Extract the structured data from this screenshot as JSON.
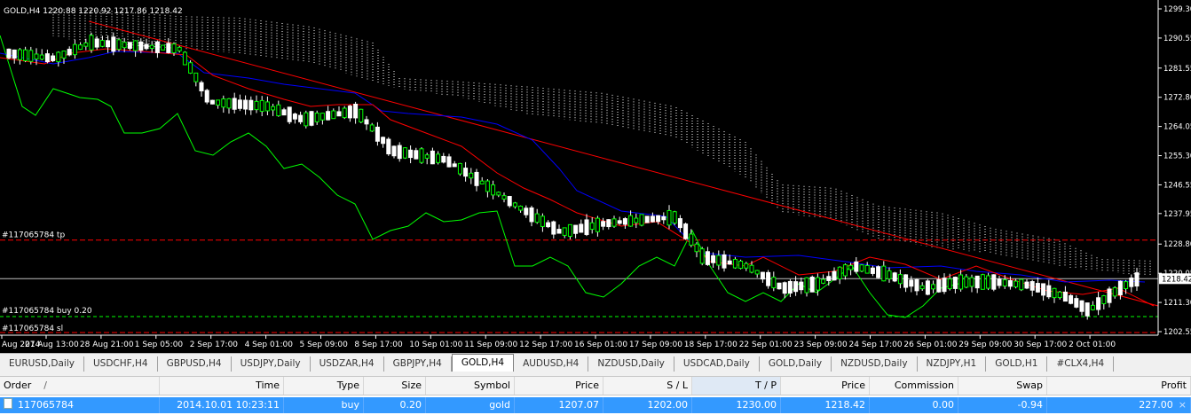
{
  "chart": {
    "symbol_label": "GOLD,H4",
    "ohlc": "1220.88 1220.92 1217.86 1218.42",
    "price_ticks": [
      "1299.30",
      "1290.55",
      "1281.55",
      "1272.80",
      "1264.05",
      "1255.30",
      "1246.55",
      "1237.95",
      "1228.80",
      "1220.05",
      "1211.30",
      "1202.55"
    ],
    "current_price": "1218.42",
    "time_labels": [
      "Aug 2014",
      "27 Aug 13:00",
      "28 Aug 21:00",
      "1 Sep 05:00",
      "2 Sep 17:00",
      "4 Sep 01:00",
      "5 Sep 09:00",
      "8 Sep 17:00",
      "10 Sep 01:00",
      "11 Sep 09:00",
      "12 Sep 17:00",
      "16 Sep 01:00",
      "17 Sep 09:00",
      "18 Sep 17:00",
      "22 Sep 01:00",
      "23 Sep 09:00",
      "24 Sep 17:00",
      "26 Sep 01:00",
      "29 Sep 09:00",
      "30 Sep 17:00",
      "2 Oct 01:00"
    ],
    "order_lines": {
      "tp_label": "#117065784 tp",
      "buy_label": "#117065784 buy 0.20",
      "sl_label": "#117065784 sl"
    },
    "colors": {
      "background": "#000000",
      "bull": "#ffffff",
      "bear": "#00ff00",
      "trend": "#ff0000",
      "kijun": "#0000ff",
      "tenkan": "#ff0000",
      "chikou": "#00ff00",
      "tp_line": "#ff0000",
      "buy_line": "#00ff00"
    }
  },
  "tabs": [
    "EURUSD,Daily",
    "USDCHF,H4",
    "GBPUSD,H4",
    "USDJPY,Daily",
    "USDZAR,H4",
    "GBPJPY,H4",
    "GOLD,H4",
    "AUDUSD,H4",
    "NZDUSD,Daily",
    "USDCAD,Daily",
    "GOLD,Daily",
    "NZDUSD,Daily",
    "NZDJPY,H1",
    "GOLD,H1",
    "#CLX4,H4"
  ],
  "active_tab": "GOLD,H4",
  "table": {
    "headers": [
      "Order",
      "Time",
      "Type",
      "Size",
      "Symbol",
      "Price",
      "S / L",
      "T / P",
      "Price",
      "Commission",
      "Swap",
      "Profit"
    ],
    "sort_indicator": "/",
    "row": [
      "117065784",
      "2014.10.01 10:23:11",
      "buy",
      "0.20",
      "gold",
      "1207.07",
      "1202.00",
      "1230.00",
      "1218.42",
      "0.00",
      "-0.94",
      "227.00"
    ]
  }
}
